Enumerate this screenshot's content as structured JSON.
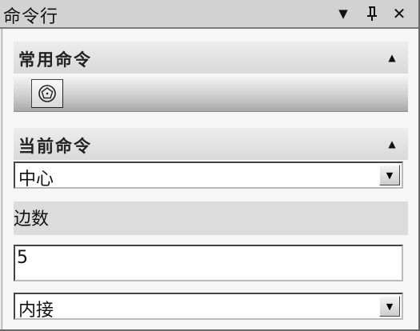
{
  "window": {
    "title": "命令行",
    "menu_glyph": "▼",
    "pin_glyph": "ᵖ",
    "close_glyph": "✕"
  },
  "sections": {
    "common": {
      "title": "常用命令",
      "collapse_glyph": "▲",
      "tools": [
        {
          "name": "polygon-tool",
          "icon": "polygon-icon"
        }
      ]
    },
    "current": {
      "title": "当前命令",
      "collapse_glyph": "▲",
      "center_mode": {
        "value": "中心"
      },
      "sides": {
        "label": "边数",
        "value": "5"
      },
      "inscribe_mode": {
        "value": "内接"
      }
    }
  },
  "combo_arrow_glyph": "▼"
}
